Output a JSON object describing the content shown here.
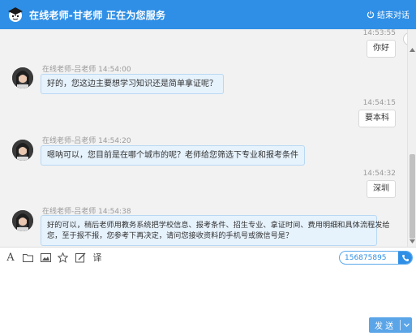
{
  "header": {
    "title": "在线老师-甘老师 正在为您服务",
    "end_label": "结束对话",
    "color": "#2f8fe6"
  },
  "messages": [
    {
      "side": "right",
      "time": "14:53:55",
      "text": "你好"
    },
    {
      "side": "left",
      "sender": "在线老师-吕老师",
      "time": "14:54:00",
      "lines": [
        "好的，您这边主要想学习知识还是简单拿证呢？"
      ]
    },
    {
      "side": "right",
      "time": "14:54:15",
      "text": "要本科"
    },
    {
      "side": "left",
      "sender": "在线老师-吕老师",
      "time": "14:54:20",
      "lines": [
        "嗯呐可以，您目前是在哪个城市的呢？老师给您筛选下专业和报考条件"
      ]
    },
    {
      "side": "right",
      "time": "14:54:32",
      "text": "深圳"
    },
    {
      "side": "left",
      "sender": "在线老师-吕老师",
      "time": "14:54:38",
      "lines": [
        "好的可以，稍后老师用教务系统把学校信息、报考条件、招生专业、拿证时间、费用明细和具体流程发给",
        "您，至于报不报，您参考下再决定，请问您接收资料的手机号或微信号是？"
      ]
    }
  ],
  "toolbar": {
    "icons": [
      "font-icon",
      "folder-icon",
      "image-icon",
      "star-icon",
      "edit-icon",
      "translate-icon"
    ],
    "translate_glyph": "译",
    "phone_value": "156875895"
  },
  "input": {
    "placeholder": ""
  },
  "send": {
    "label": "发 送"
  }
}
